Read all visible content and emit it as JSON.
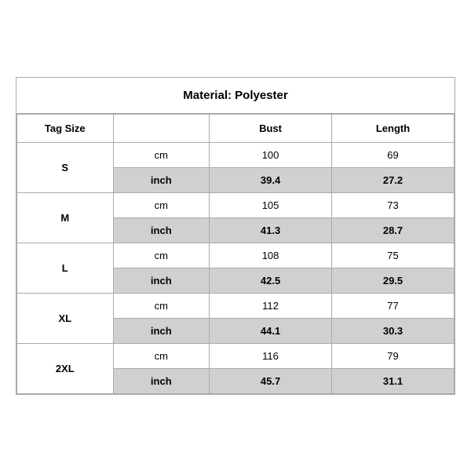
{
  "title": "Material: Polyester",
  "headers": {
    "tag_size": "Tag Size",
    "bust": "Bust",
    "length": "Length"
  },
  "rows": [
    {
      "size": "S",
      "cm_bust": "100",
      "cm_length": "69",
      "inch_bust": "39.4",
      "inch_length": "27.2"
    },
    {
      "size": "M",
      "cm_bust": "105",
      "cm_length": "73",
      "inch_bust": "41.3",
      "inch_length": "28.7"
    },
    {
      "size": "L",
      "cm_bust": "108",
      "cm_length": "75",
      "inch_bust": "42.5",
      "inch_length": "29.5"
    },
    {
      "size": "XL",
      "cm_bust": "112",
      "cm_length": "77",
      "inch_bust": "44.1",
      "inch_length": "30.3"
    },
    {
      "size": "2XL",
      "cm_bust": "116",
      "cm_length": "79",
      "inch_bust": "45.7",
      "inch_length": "31.1"
    }
  ],
  "units": {
    "cm": "cm",
    "inch": "inch"
  }
}
